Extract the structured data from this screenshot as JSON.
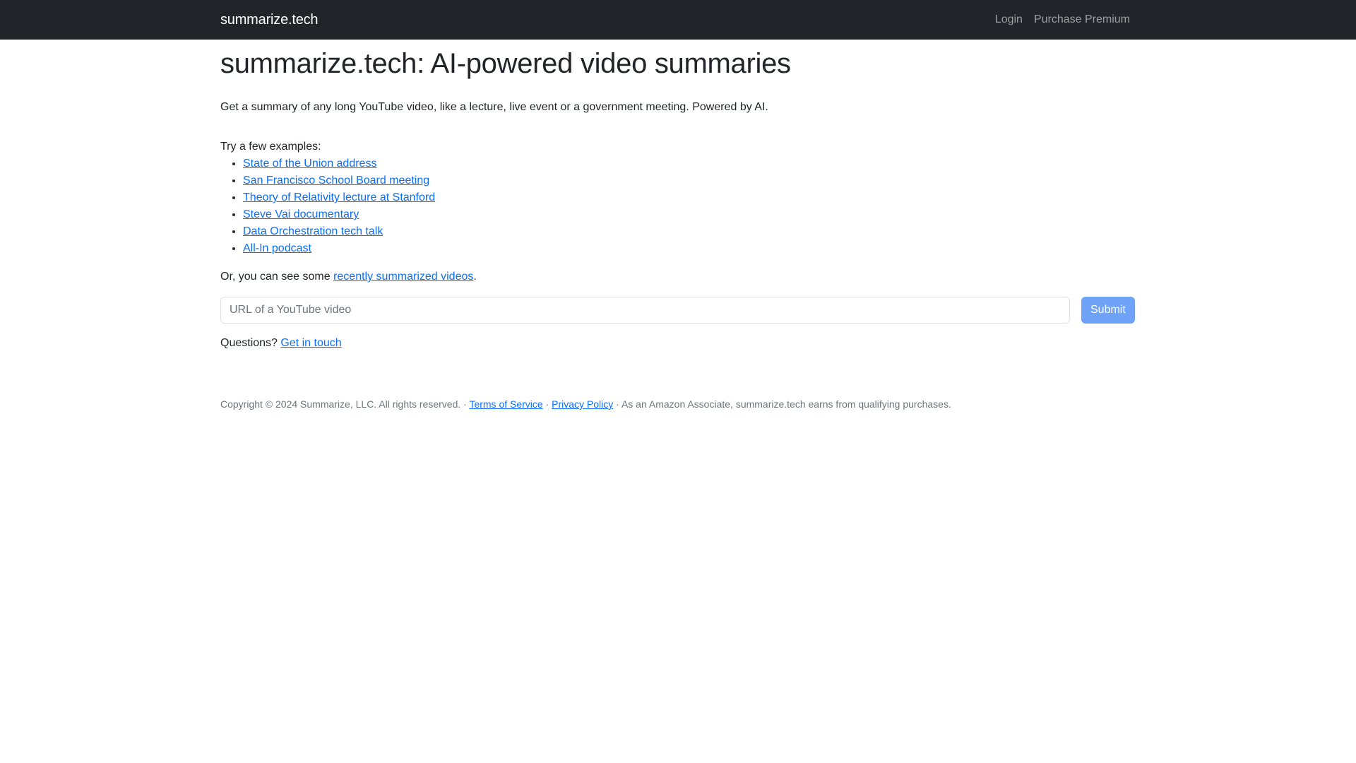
{
  "navbar": {
    "brand": "summarize.tech",
    "links": [
      {
        "label": "Login"
      },
      {
        "label": "Purchase Premium"
      }
    ]
  },
  "main": {
    "title": "summarize.tech: AI-powered video summaries",
    "lead": "Get a summary of any long YouTube video, like a lecture, live event or a government meeting. Powered by AI.",
    "examples_label": "Try a few examples:",
    "examples": [
      {
        "label": "State of the Union address"
      },
      {
        "label": "San Francisco School Board meeting"
      },
      {
        "label": "Theory of Relativity lecture at Stanford"
      },
      {
        "label": "Steve Vai documentary"
      },
      {
        "label": "Data Orchestration tech talk"
      },
      {
        "label": "All-In podcast"
      }
    ],
    "recent_prefix": "Or, you can see some ",
    "recent_link": "recently summarized videos",
    "recent_suffix": ".",
    "url_input": {
      "value": "",
      "placeholder": "URL of a YouTube video"
    },
    "submit_label": "Submit",
    "questions_prefix": "Questions? ",
    "questions_link": "Get in touch"
  },
  "footer": {
    "copyright": "Copyright © 2024 Summarize, LLC. All rights reserved. · ",
    "terms": "Terms of Service",
    "sep": " · ",
    "privacy": "Privacy Policy",
    "amazon": " · As an Amazon Associate, summarize.tech earns from qualifying purchases."
  },
  "colors": {
    "navbar_bg": "#212529",
    "link": "#0d6efd",
    "submit_bg": "#6ea3f7"
  }
}
